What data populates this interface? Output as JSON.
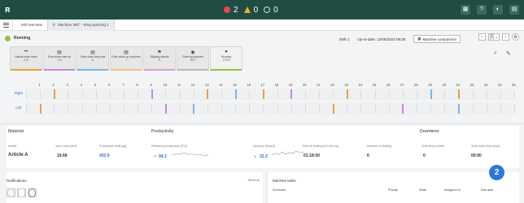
{
  "topbar": {
    "logo": "ʀ",
    "counts": {
      "errors": "2",
      "warnings": "0",
      "info": "0"
    }
  },
  "breadcrumb": {
    "home": "Mill overview",
    "machine": "Machine 360° - Ring spinning 1"
  },
  "status": {
    "label": "Running",
    "shift": "Shift 1",
    "uptodate": "Up-to-date: 12/05/2023 08:36",
    "compare": "Machine comparison",
    "page": "1"
  },
  "cards": [
    {
      "icon": "••",
      "label": "Natural ends down",
      "value": "210",
      "color": "#e8a23c"
    },
    {
      "icon": "▤",
      "label": "Ends down start up",
      "value": "170",
      "color": "#c88ad6"
    },
    {
      "icon": "▤",
      "label": "Ends down long time",
      "value": "11",
      "color": "#7fb3e6"
    },
    {
      "icon": "▤",
      "label": "Ends down up long time",
      "value": "1",
      "color": "#f0c27a"
    },
    {
      "icon": "⚑",
      "label": "Slipping spindle",
      "value": "11",
      "color": "#d2a0d8"
    },
    {
      "icon": "◉",
      "label": "Running required",
      "value": "4871",
      "color": "#b8b8b8"
    },
    {
      "icon": "●",
      "label": "Running",
      "value": "17034",
      "color": "#9bbf3a",
      "active": true
    }
  ],
  "spindles": {
    "numbers": [
      "1",
      "2",
      "3",
      "4",
      "5",
      "6",
      "7",
      "8",
      "9",
      "10",
      "11",
      "12",
      "13",
      "14",
      "15",
      "16",
      "17",
      "18",
      "19",
      "20",
      "21",
      "22",
      "23",
      "24",
      "25",
      "26",
      "27",
      "28",
      "29",
      "30",
      "31",
      "32",
      "33",
      "34",
      "35"
    ],
    "right_label": "Right",
    "left_label": "Left",
    "right_marks": [
      2,
      9,
      13,
      15,
      17,
      19,
      23,
      29,
      31
    ],
    "left_marks": [
      1,
      10,
      12,
      22,
      27,
      31
    ]
  },
  "material": {
    "title": "Material",
    "article_label": "Article",
    "article": "Article A",
    "yarn_label": "Yarn count [tex]",
    "yarn": "19.68",
    "prod_shift_label": "Production shift [kg]",
    "prod_shift": "432.9"
  },
  "productivity": {
    "title": "Productivity",
    "eff_label": "Efficiency production [P%]",
    "eff": "94.3",
    "delivery_label": "Delivery [m/min]",
    "delivery": "22.3",
    "doffing_time_label": "Time till doffing [hh:mm:ss]",
    "doffing_time": "01:18:00",
    "num_doffing_label": "Number of doffing",
    "num_doffing": "6"
  },
  "downtime": {
    "title": "Downtime",
    "events_label": "Shift stop events",
    "events": "0",
    "time_label": "Shift down time [min]",
    "time": "00:00"
  },
  "notifications": {
    "title": "Notifications",
    "show_all": "Show all"
  },
  "tasks": {
    "title": "Machine tasks",
    "cols": [
      "Summary",
      "Priority",
      "State",
      "Assigned to",
      "Due date"
    ]
  },
  "badge": "2"
}
